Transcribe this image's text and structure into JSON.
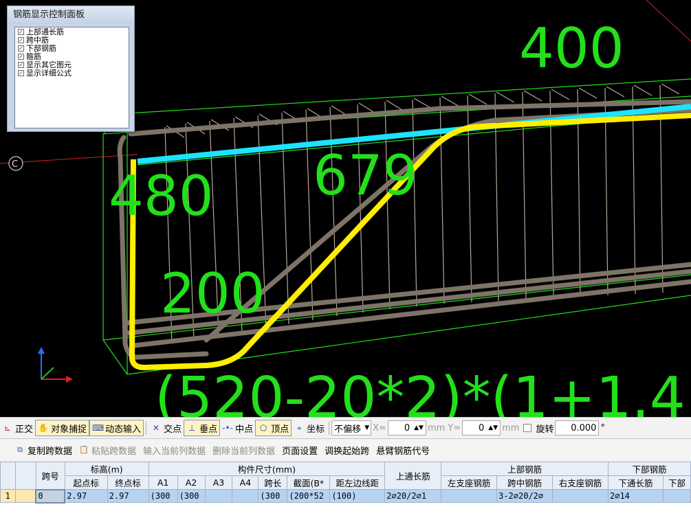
{
  "viewport": {
    "dimensions": [
      "400",
      "480",
      "679",
      "200"
    ],
    "formula": "(520-20*2)*(1+1.4",
    "colors": {
      "background": "#000000",
      "green": "#22e01a",
      "yellow": "#ffee00",
      "cyan": "#1ee3ff",
      "rebar": "#8a8070"
    },
    "axis_marker": "C"
  },
  "control_panel": {
    "title": "钢筋显示控制面板",
    "items": [
      {
        "label": "上部通长筋",
        "checked": true
      },
      {
        "label": "跨中筋",
        "checked": true
      },
      {
        "label": "下部钢筋",
        "checked": true
      },
      {
        "label": "箍筋",
        "checked": true
      },
      {
        "label": "显示其它图元",
        "checked": true
      },
      {
        "label": "显示详细公式",
        "checked": true
      }
    ]
  },
  "toolbar": {
    "ortho": "正交",
    "snap": "对象捕捉",
    "dynamic_input": "动态输入",
    "intersection": "交点",
    "perpendicular": "垂点",
    "midpoint": "中点",
    "vertex": "顶点",
    "coordinate": "坐标",
    "offset_select": "不偏移",
    "x_label": "X=",
    "x_value": "0",
    "unit1": "mm",
    "y_label": "Y=",
    "y_value": "0",
    "unit2": "mm",
    "rotate_label": "旋转",
    "rotate_value": "0.000",
    "degree": "°"
  },
  "toolbar2": {
    "copy_span": "复制跨数据",
    "paste_span": "粘贴跨数据",
    "input_current_col": "输入当前列数据",
    "delete_current_col": "删除当前列数据",
    "page_setup": "页面设置",
    "swap_start": "调换起始跨",
    "cantilever_code": "悬臂钢筋代号"
  },
  "grid": {
    "header1": {
      "span_no": "跨号",
      "elevation": "标高(m)",
      "size": "构件尺寸(mm)",
      "top_through": "上通长筋",
      "top_rebar": "上部钢筋",
      "bottom_rebar": "下部钢筋"
    },
    "header2": [
      "起点标",
      "终点标",
      "A1",
      "A2",
      "A3",
      "A4",
      "跨长",
      "截面(B*",
      "距左边线距",
      "左支座钢筋",
      "跨中钢筋",
      "右支座钢筋",
      "下通长筋",
      "下部"
    ],
    "row": {
      "row_no": "1",
      "span_no": "0",
      "start_elev": "2.97",
      "end_elev": "2.97",
      "a1": "(300",
      "a2": "(300",
      "a3": "",
      "a4": "",
      "span_len": "(300",
      "section": "(200*52",
      "offset": "(100)",
      "top_through": "2⌀20/2⌀1",
      "left_support": "",
      "mid_span": "3-2⌀20/2⌀",
      "right_support": "",
      "bottom_through": "2⌀14",
      "bottom_part": ""
    }
  }
}
